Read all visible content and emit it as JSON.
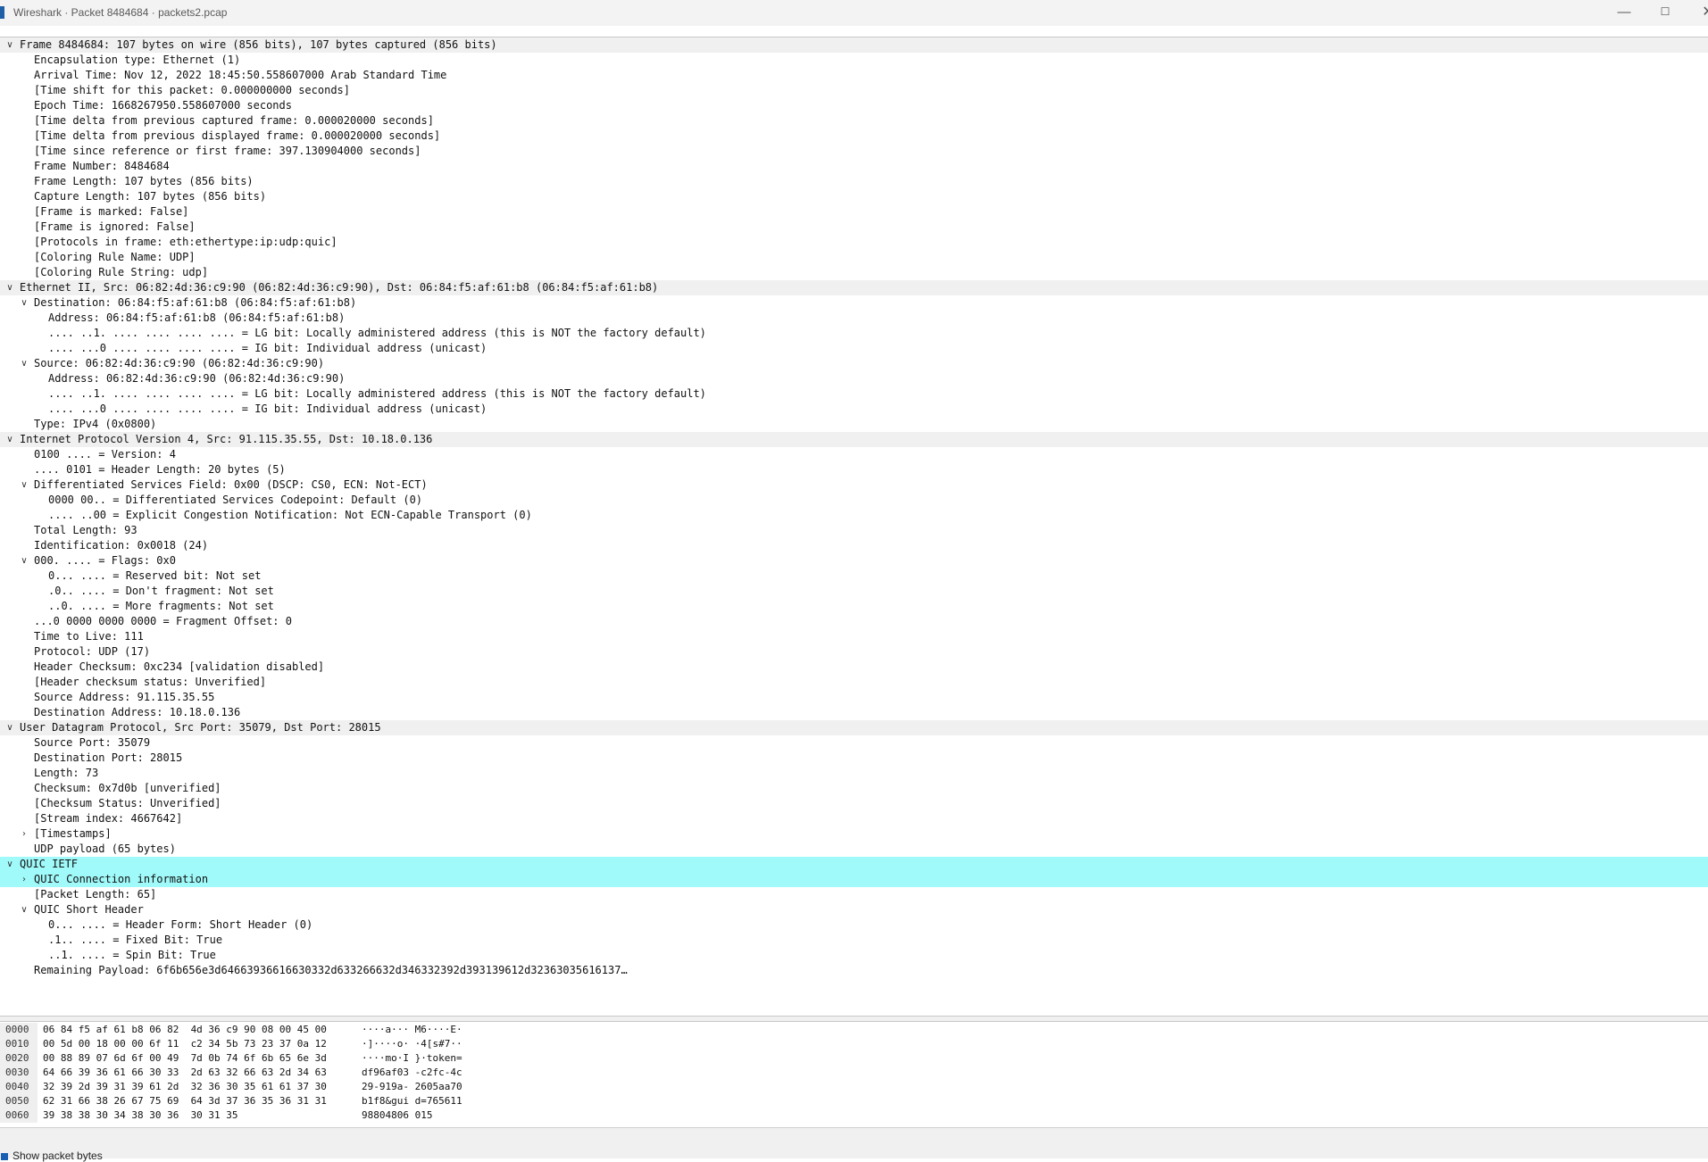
{
  "window": {
    "title": "Wireshark · Packet 8484684 · packets2.pcap",
    "minimize": "—",
    "maximize": "☐",
    "close": "✕"
  },
  "tree": [
    {
      "text": "Frame 8484684: 107 bytes on wire (856 bits), 107 bytes captured (856 bits)",
      "level": 0,
      "toggle": "open",
      "style": "band"
    },
    {
      "text": "Encapsulation type: Ethernet (1)",
      "level": 1
    },
    {
      "text": "Arrival Time: Nov 12, 2022 18:45:50.558607000 Arab Standard Time",
      "level": 1
    },
    {
      "text": "[Time shift for this packet: 0.000000000 seconds]",
      "level": 1
    },
    {
      "text": "Epoch Time: 1668267950.558607000 seconds",
      "level": 1
    },
    {
      "text": "[Time delta from previous captured frame: 0.000020000 seconds]",
      "level": 1
    },
    {
      "text": "[Time delta from previous displayed frame: 0.000020000 seconds]",
      "level": 1
    },
    {
      "text": "[Time since reference or first frame: 397.130904000 seconds]",
      "level": 1
    },
    {
      "text": "Frame Number: 8484684",
      "level": 1
    },
    {
      "text": "Frame Length: 107 bytes (856 bits)",
      "level": 1
    },
    {
      "text": "Capture Length: 107 bytes (856 bits)",
      "level": 1
    },
    {
      "text": "[Frame is marked: False]",
      "level": 1
    },
    {
      "text": "[Frame is ignored: False]",
      "level": 1
    },
    {
      "text": "[Protocols in frame: eth:ethertype:ip:udp:quic]",
      "level": 1
    },
    {
      "text": "[Coloring Rule Name: UDP]",
      "level": 1
    },
    {
      "text": "[Coloring Rule String: udp]",
      "level": 1
    },
    {
      "text": "Ethernet II, Src: 06:82:4d:36:c9:90 (06:82:4d:36:c9:90), Dst: 06:84:f5:af:61:b8 (06:84:f5:af:61:b8)",
      "level": 0,
      "toggle": "open",
      "style": "band"
    },
    {
      "text": "Destination: 06:84:f5:af:61:b8 (06:84:f5:af:61:b8)",
      "level": 1,
      "toggle": "open"
    },
    {
      "text": "Address: 06:84:f5:af:61:b8 (06:84:f5:af:61:b8)",
      "level": 2
    },
    {
      "text": ".... ..1. .... .... .... .... = LG bit: Locally administered address (this is NOT the factory default)",
      "level": 2
    },
    {
      "text": ".... ...0 .... .... .... .... = IG bit: Individual address (unicast)",
      "level": 2
    },
    {
      "text": "Source: 06:82:4d:36:c9:90 (06:82:4d:36:c9:90)",
      "level": 1,
      "toggle": "open"
    },
    {
      "text": "Address: 06:82:4d:36:c9:90 (06:82:4d:36:c9:90)",
      "level": 2
    },
    {
      "text": ".... ..1. .... .... .... .... = LG bit: Locally administered address (this is NOT the factory default)",
      "level": 2
    },
    {
      "text": ".... ...0 .... .... .... .... = IG bit: Individual address (unicast)",
      "level": 2
    },
    {
      "text": "Type: IPv4 (0x0800)",
      "level": 1
    },
    {
      "text": "Internet Protocol Version 4, Src: 91.115.35.55, Dst: 10.18.0.136",
      "level": 0,
      "toggle": "open",
      "style": "band"
    },
    {
      "text": "0100 .... = Version: 4",
      "level": 1
    },
    {
      "text": ".... 0101 = Header Length: 20 bytes (5)",
      "level": 1
    },
    {
      "text": "Differentiated Services Field: 0x00 (DSCP: CS0, ECN: Not-ECT)",
      "level": 1,
      "toggle": "open"
    },
    {
      "text": "0000 00.. = Differentiated Services Codepoint: Default (0)",
      "level": 2
    },
    {
      "text": ".... ..00 = Explicit Congestion Notification: Not ECN-Capable Transport (0)",
      "level": 2
    },
    {
      "text": "Total Length: 93",
      "level": 1
    },
    {
      "text": "Identification: 0x0018 (24)",
      "level": 1
    },
    {
      "text": "000. .... = Flags: 0x0",
      "level": 1,
      "toggle": "open"
    },
    {
      "text": "0... .... = Reserved bit: Not set",
      "level": 2
    },
    {
      "text": ".0.. .... = Don't fragment: Not set",
      "level": 2
    },
    {
      "text": "..0. .... = More fragments: Not set",
      "level": 2
    },
    {
      "text": "...0 0000 0000 0000 = Fragment Offset: 0",
      "level": 1
    },
    {
      "text": "Time to Live: 111",
      "level": 1
    },
    {
      "text": "Protocol: UDP (17)",
      "level": 1
    },
    {
      "text": "Header Checksum: 0xc234 [validation disabled]",
      "level": 1
    },
    {
      "text": "[Header checksum status: Unverified]",
      "level": 1
    },
    {
      "text": "Source Address: 91.115.35.55",
      "level": 1
    },
    {
      "text": "Destination Address: 10.18.0.136",
      "level": 1
    },
    {
      "text": "User Datagram Protocol, Src Port: 35079, Dst Port: 28015",
      "level": 0,
      "toggle": "open",
      "style": "band"
    },
    {
      "text": "Source Port: 35079",
      "level": 1
    },
    {
      "text": "Destination Port: 28015",
      "level": 1
    },
    {
      "text": "Length: 73",
      "level": 1
    },
    {
      "text": "Checksum: 0x7d0b [unverified]",
      "level": 1
    },
    {
      "text": "[Checksum Status: Unverified]",
      "level": 1
    },
    {
      "text": "[Stream index: 4667642]",
      "level": 1
    },
    {
      "text": "[Timestamps]",
      "level": 1,
      "toggle": "closed"
    },
    {
      "text": "UDP payload (65 bytes)",
      "level": 1
    },
    {
      "text": "QUIC IETF",
      "level": 0,
      "toggle": "open",
      "style": "quic"
    },
    {
      "text": "QUIC Connection information",
      "level": 1,
      "toggle": "closed",
      "style": "selected"
    },
    {
      "text": "[Packet Length: 65]",
      "level": 1
    },
    {
      "text": "QUIC Short Header",
      "level": 1,
      "toggle": "open"
    },
    {
      "text": "0... .... = Header Form: Short Header (0)",
      "level": 2
    },
    {
      "text": ".1.. .... = Fixed Bit: True",
      "level": 2
    },
    {
      "text": "..1. .... = Spin Bit: True",
      "level": 2
    },
    {
      "text": "Remaining Payload: 6f6b656e3d64663936616630332d633266632d346332392d393139612d32363035616137…",
      "level": 1
    }
  ],
  "bytes": [
    {
      "offset": "0000",
      "hex": "06 84 f5 af 61 b8 06 82  4d 36 c9 90 08 00 45 00",
      "ascii": "····a··· M6····E·"
    },
    {
      "offset": "0010",
      "hex": "00 5d 00 18 00 00 6f 11  c2 34 5b 73 23 37 0a 12",
      "ascii": "·]····o· ·4[s#7··"
    },
    {
      "offset": "0020",
      "hex": "00 88 89 07 6d 6f 00 49  7d 0b 74 6f 6b 65 6e 3d",
      "ascii": "····mo·I }·token="
    },
    {
      "offset": "0030",
      "hex": "64 66 39 36 61 66 30 33  2d 63 32 66 63 2d 34 63",
      "ascii": "df96af03 -c2fc-4c"
    },
    {
      "offset": "0040",
      "hex": "32 39 2d 39 31 39 61 2d  32 36 30 35 61 61 37 30",
      "ascii": "29-919a- 2605aa70"
    },
    {
      "offset": "0050",
      "hex": "62 31 66 38 26 67 75 69  64 3d 37 36 35 36 31 31",
      "ascii": "b1f8&gui d=765611"
    },
    {
      "offset": "0060",
      "hex": "39 38 38 30 34 38 30 36  30 31 35",
      "ascii": "98804806 015"
    }
  ],
  "statusbar": {
    "label": "Show packet bytes"
  },
  "colors": {
    "band": "#f0f0f0",
    "quic_highlight": "#a0fafa",
    "accent": "#1a5fb4"
  }
}
